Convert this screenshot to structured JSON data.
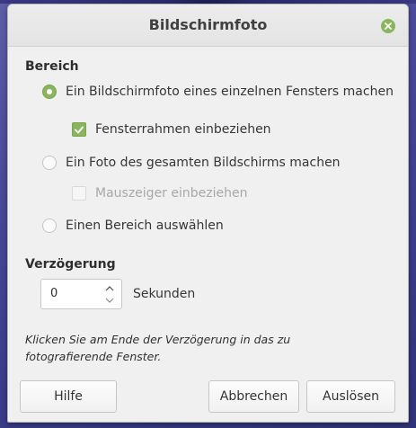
{
  "window": {
    "title": "Bildschirmfoto",
    "close_icon": "close-icon",
    "accent": "#8ab55e"
  },
  "area": {
    "heading": "Bereich",
    "options": [
      {
        "label": "Ein Bildschirmfoto eines einzelnen Fensters machen",
        "selected": true
      },
      {
        "label": "Ein Foto des gesamten Bildschirms machen",
        "selected": false
      },
      {
        "label": "Einen Bereich auswählen",
        "selected": false
      }
    ],
    "window_frame_label": "Fensterrahmen einbeziehen",
    "window_frame_checked": true,
    "pointer_label": "Mauszeiger einbeziehen",
    "pointer_checked": false,
    "pointer_enabled": false
  },
  "delay": {
    "heading": "Verzögerung",
    "value": "0",
    "unit": "Sekunden"
  },
  "hint": "Klicken Sie am Ende der Verzögerung in das zu fotografierende Fenster.",
  "buttons": {
    "help": "Hilfe",
    "cancel": "Abbrechen",
    "capture": "Auslösen"
  }
}
